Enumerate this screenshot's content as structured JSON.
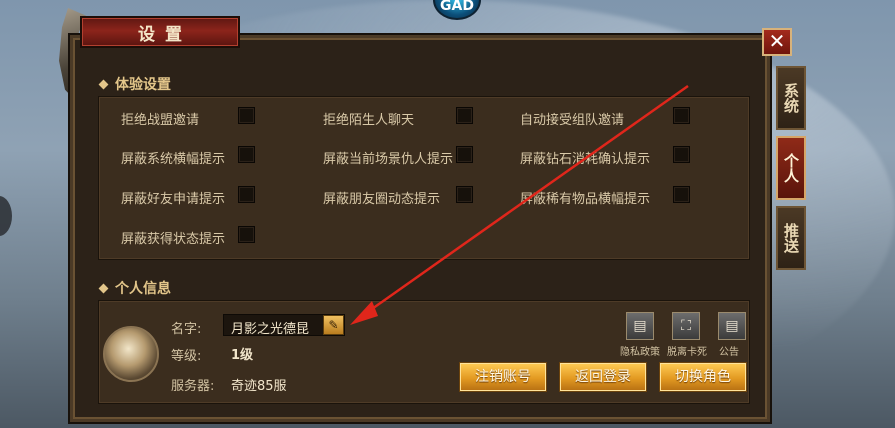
{
  "window": {
    "title": "设置",
    "close_symbol": "✕"
  },
  "side_tabs": [
    {
      "label": "系统",
      "active": false
    },
    {
      "label": "个人",
      "active": true
    },
    {
      "label": "推送",
      "active": false
    }
  ],
  "experience": {
    "header": "体验设置",
    "options": [
      "拒绝战盟邀请",
      "拒绝陌生人聊天",
      "自动接受组队邀请",
      "屏蔽系统横幅提示",
      "屏蔽当前场景仇人提示",
      "屏蔽钻石消耗确认提示",
      "屏蔽好友申请提示",
      "屏蔽朋友圈动态提示",
      "屏蔽稀有物品横幅提示",
      "屏蔽获得状态提示"
    ]
  },
  "personal": {
    "header": "个人信息",
    "name_label": "名字:",
    "name_value": "月影之光德昆",
    "level_label": "等级:",
    "level_value": "1级",
    "server_label": "服务器:",
    "server_value": "奇迹85服",
    "icons": [
      {
        "label": "隐私政策",
        "icon": "document-icon"
      },
      {
        "label": "脱离卡死",
        "icon": "unstuck-icon"
      },
      {
        "label": "公告",
        "icon": "notice-icon"
      }
    ],
    "buttons": {
      "logout": "注销账号",
      "back_login": "返回登录",
      "switch_role": "切换角色"
    }
  },
  "misc": {
    "top_emblem": "GAD"
  },
  "colors": {
    "accent_gold": "#e3c68a",
    "button_gold": "#e39a22",
    "title_red": "#8c241b",
    "annotation_red": "#e0261b"
  }
}
